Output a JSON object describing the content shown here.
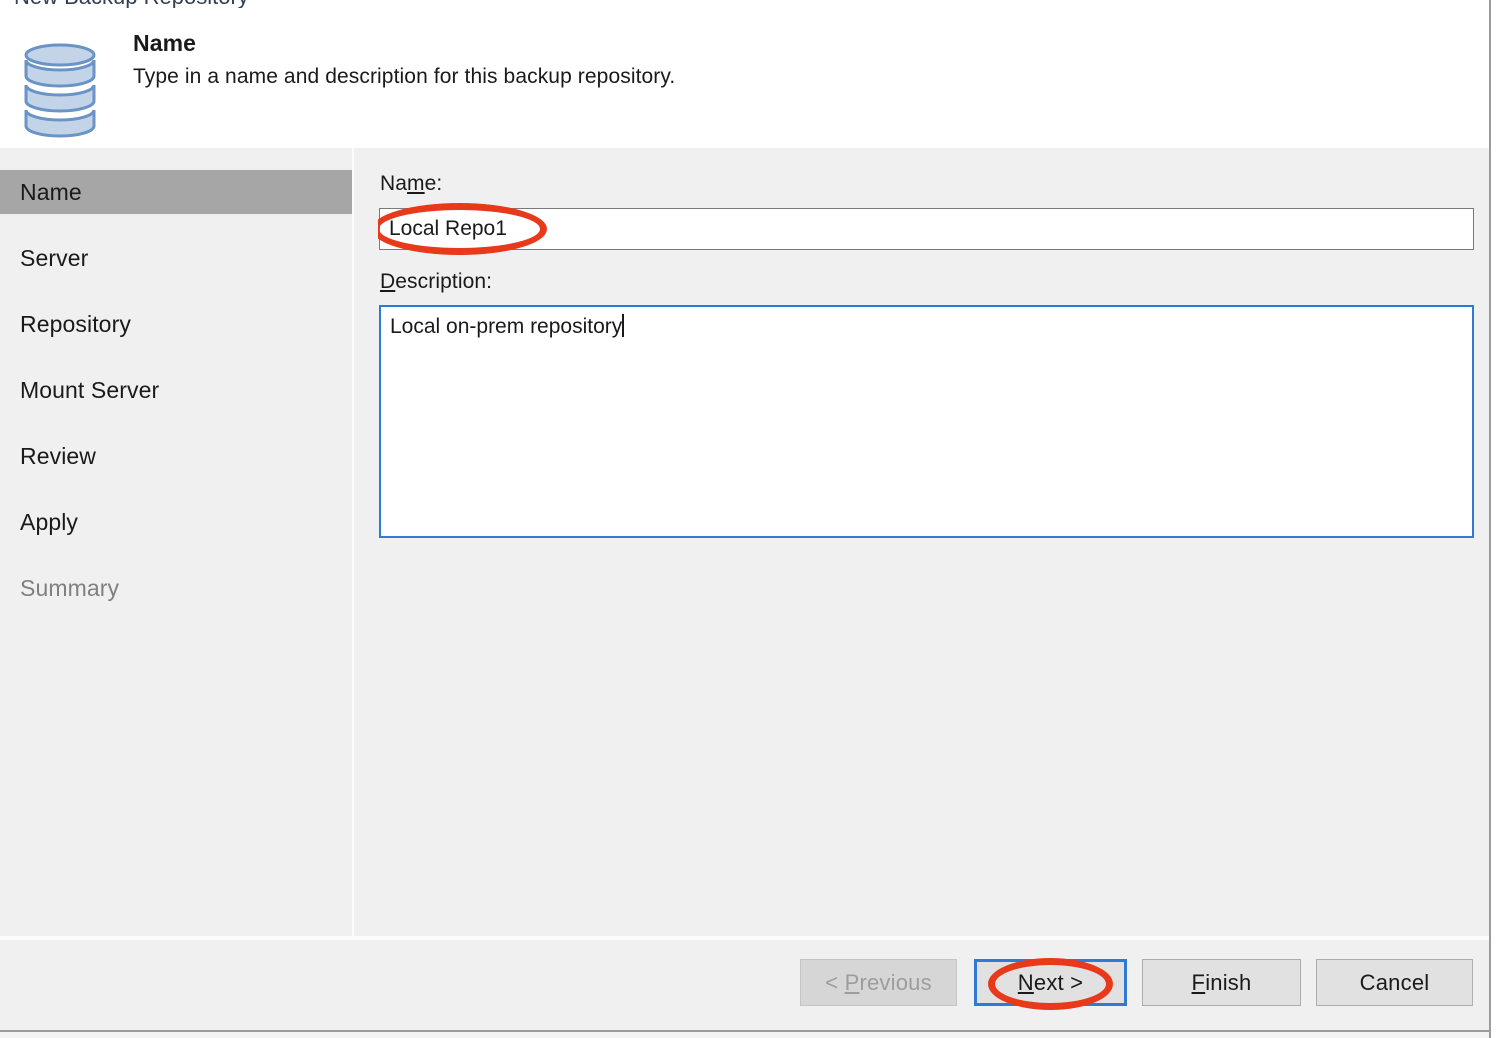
{
  "window": {
    "title": "New Backup Repository"
  },
  "header": {
    "icon": "database-repository-icon",
    "title": "Name",
    "subtitle": "Type in a name and description for this backup repository."
  },
  "sidebar": {
    "items": [
      {
        "label": "Name",
        "state": "selected"
      },
      {
        "label": "Server",
        "state": "normal"
      },
      {
        "label": "Repository",
        "state": "normal"
      },
      {
        "label": "Mount Server",
        "state": "normal"
      },
      {
        "label": "Review",
        "state": "normal"
      },
      {
        "label": "Apply",
        "state": "normal"
      },
      {
        "label": "Summary",
        "state": "disabled"
      }
    ]
  },
  "form": {
    "name_label_pre": "Na",
    "name_label_accel": "m",
    "name_label_post": "e:",
    "name_value": "Local Repo1",
    "name_placeholder": "",
    "description_label_accel": "D",
    "description_label_post": "escription:",
    "description_value": "Local on-prem repository",
    "description_placeholder": ""
  },
  "footer": {
    "buttons": [
      {
        "name": "previous",
        "pre": "< ",
        "accel": "P",
        "post": "revious",
        "state": "disabled"
      },
      {
        "name": "next",
        "pre": "",
        "accel": "N",
        "post": "ext >",
        "state": "default"
      },
      {
        "name": "finish",
        "pre": "",
        "accel": "F",
        "post": "inish",
        "state": "normal"
      },
      {
        "name": "cancel",
        "pre": "",
        "accel": "",
        "post": "Cancel",
        "state": "normal"
      }
    ]
  },
  "annotations": {
    "color": "#e8391a",
    "targets": [
      "name-input",
      "next-button"
    ]
  },
  "colors": {
    "window_bg": "#ffffff",
    "panel_bg": "#f0f0f0",
    "selected_nav_bg": "#a6a6a6",
    "disabled_text": "#808080",
    "focus_border": "#2f7bd4",
    "input_border": "#7a7a7a",
    "button_bg": "#e1e1e1",
    "annotation_red": "#e8391a",
    "icon_fill": "#c3d4e9",
    "icon_stroke": "#6a93c6"
  }
}
